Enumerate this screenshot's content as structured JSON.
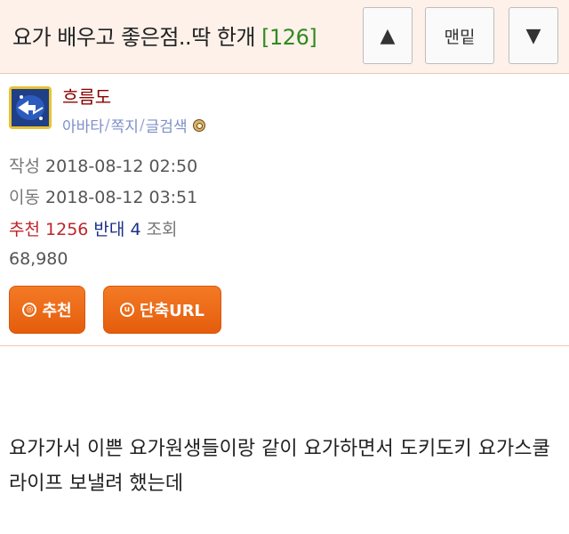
{
  "header": {
    "title": "요가 배우고 좋은점..딱 한개",
    "comment_count": "[126]",
    "up_label": "▲",
    "bottom_label": "맨밑",
    "down_label": "▼"
  },
  "author": {
    "name": "흐름도",
    "links": [
      "아바타",
      "쪽지",
      "글검색"
    ],
    "level_icon": "level-badge-icon"
  },
  "meta": {
    "written_label": "작성",
    "written_value": "2018-08-12 02:50",
    "moved_label": "이동",
    "moved_value": "2018-08-12 03:51",
    "recommend_label": "추천",
    "recommend_value": "1256",
    "oppose_label": "반대",
    "oppose_value": "4",
    "views_label": "조회",
    "views_value": "68,980"
  },
  "buttons": {
    "recommend": "추천",
    "short_url": "단축URL"
  },
  "body": {
    "text": "요가가서 이쁜 요가원생들이랑 같이 요가하면서 도키도키 요가스쿨 라이프 보낼려 했는데"
  },
  "colors": {
    "header_bg": "#fdf1ea",
    "comment_count": "#2f8a1f",
    "author_name": "#8b0000",
    "links": "#7f8fc9",
    "recommend": "#c0242a",
    "oppose": "#1a2f8a",
    "button_orange": "#f06a1a"
  }
}
